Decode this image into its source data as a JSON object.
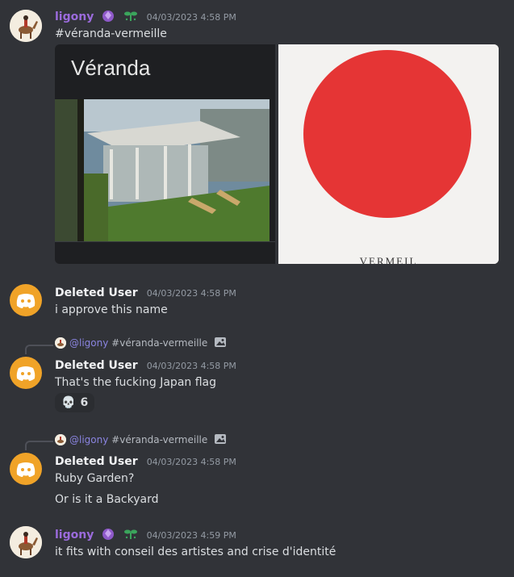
{
  "messages": [
    {
      "author": "ligony",
      "timestamp": "04/03/2023 4:58 PM",
      "text": "#véranda-vermeille",
      "attachments": [
        {
          "title": "Véranda"
        },
        {
          "caption": "VERMEIL"
        }
      ]
    },
    {
      "author": "Deleted User",
      "timestamp": "04/03/2023 4:58 PM",
      "text": "i approve this name"
    },
    {
      "reply_to": {
        "mention": "@ligony",
        "text": "#véranda-vermeille"
      },
      "author": "Deleted User",
      "timestamp": "04/03/2023 4:58 PM",
      "text": "That's the fucking Japan flag",
      "reaction": {
        "emoji": "💀",
        "count": "6"
      }
    },
    {
      "reply_to": {
        "mention": "@ligony",
        "text": "#véranda-vermeille"
      },
      "author": "Deleted User",
      "timestamp": "04/03/2023 4:58 PM",
      "text": "Ruby Garden?",
      "text2": "Or is it a Backyard"
    },
    {
      "author": "ligony",
      "timestamp": "04/03/2023 4:59 PM",
      "text": "it fits with conseil des artistes and crise d'identité"
    }
  ],
  "colors": {
    "background": "#313338",
    "username_purple": "#9b6bdc",
    "mention": "#8a84e0",
    "flag_red": "#e53535",
    "deleted_avatar": "#f0a328"
  }
}
